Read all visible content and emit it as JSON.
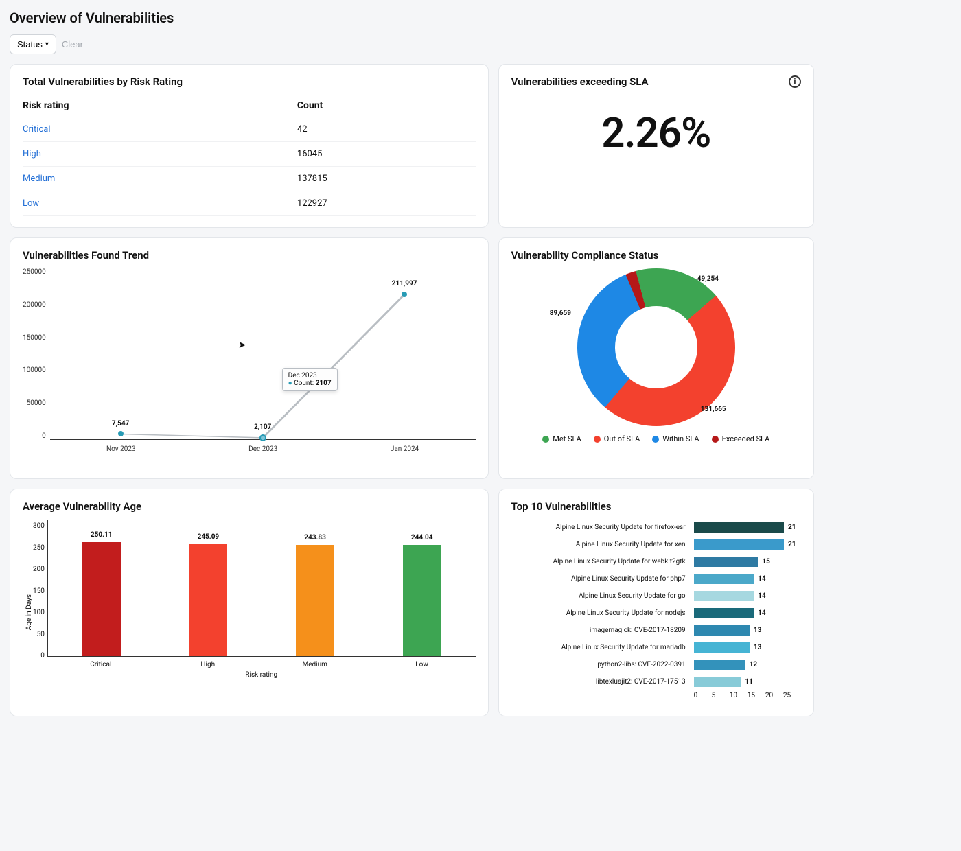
{
  "page_title": "Overview of Vulnerabilities",
  "filters": {
    "status_label": "Status",
    "clear_label": "Clear"
  },
  "risk_table": {
    "title": "Total Vulnerabilities by Risk Rating",
    "columns": [
      "Risk rating",
      "Count"
    ],
    "rows": [
      {
        "rating": "Critical",
        "count": "42"
      },
      {
        "rating": "High",
        "count": "16045"
      },
      {
        "rating": "Medium",
        "count": "137815"
      },
      {
        "rating": "Low",
        "count": "122927"
      }
    ]
  },
  "sla_card": {
    "title": "Vulnerabilities exceeding SLA",
    "value": "2.26%"
  },
  "trend_card": {
    "title": "Vulnerabilities Found Trend"
  },
  "compliance_card": {
    "title": "Vulnerability Compliance Status",
    "legend": [
      {
        "label": "Met SLA",
        "color": "#3da552"
      },
      {
        "label": "Out of SLA",
        "color": "#f3412e"
      },
      {
        "label": "Within SLA",
        "color": "#1e88e5"
      },
      {
        "label": "Exceeded SLA",
        "color": "#b51818"
      }
    ]
  },
  "age_card": {
    "title": "Average Vulnerability Age",
    "ylabel": "Age in Days",
    "xlabel": "Risk rating"
  },
  "top_card": {
    "title": "Top 10 Vulnerabilities"
  },
  "tooltip": {
    "header": "Dec 2023",
    "series_label": "Count:",
    "value": "2107"
  },
  "chart_data": [
    {
      "id": "trend",
      "type": "line",
      "title": "Vulnerabilities Found Trend",
      "x": [
        "Nov 2023",
        "Dec 2023",
        "Jan 2024"
      ],
      "values": [
        7547,
        2107,
        211997
      ],
      "value_labels": [
        "7,547",
        "2,107",
        "211,997"
      ],
      "ylim": [
        0,
        250000
      ],
      "yticks": [
        0,
        50000,
        100000,
        150000,
        200000,
        250000
      ]
    },
    {
      "id": "compliance",
      "type": "pie",
      "title": "Vulnerability Compliance Status",
      "series": [
        {
          "name": "Met SLA",
          "value": 49254,
          "label": "49,254",
          "color": "#3da552"
        },
        {
          "name": "Out of SLA",
          "value": 131665,
          "label": "131,665",
          "color": "#f3412e"
        },
        {
          "name": "Within SLA",
          "value": 89659,
          "label": "89,659",
          "color": "#1e88e5"
        },
        {
          "name": "Exceeded SLA",
          "value": 6000,
          "label": "",
          "color": "#b51818"
        }
      ]
    },
    {
      "id": "age",
      "type": "bar",
      "title": "Average Vulnerability Age",
      "xlabel": "Risk rating",
      "ylabel": "Age in Days",
      "categories": [
        "Critical",
        "High",
        "Medium",
        "Low"
      ],
      "values": [
        250.11,
        245.09,
        243.83,
        244.04
      ],
      "colors": [
        "#c21d1d",
        "#f3412e",
        "#f5901b",
        "#3da552"
      ],
      "ylim": [
        0,
        300
      ],
      "yticks": [
        0,
        50,
        100,
        150,
        200,
        250,
        300
      ]
    },
    {
      "id": "top10",
      "type": "bar",
      "orientation": "horizontal",
      "title": "Top 10 Vulnerabilities",
      "xlim": [
        0,
        25
      ],
      "xticks": [
        0,
        5,
        10,
        15,
        20,
        25
      ],
      "categories": [
        "Alpine Linux Security Update for firefox-esr",
        "Alpine Linux Security Update for xen",
        "Alpine Linux Security Update for webkit2gtk",
        "Alpine Linux Security Update for php7",
        "Alpine Linux Security Update for go",
        "Alpine Linux Security Update for nodejs",
        "imagemagick: CVE-2017-18209",
        "Alpine Linux Security Update for mariadb",
        "python2-libs: CVE-2022-0391",
        "libtexluajit2: CVE-2017-17513"
      ],
      "values": [
        21,
        21,
        15,
        14,
        14,
        14,
        13,
        13,
        12,
        11
      ],
      "colors": [
        "#1a4a4a",
        "#3a9acb",
        "#2e7aa3",
        "#4ba8c9",
        "#a6d8e0",
        "#1a6a7a",
        "#2e88b0",
        "#46b4d4",
        "#3392bb",
        "#88cbd8"
      ]
    }
  ]
}
